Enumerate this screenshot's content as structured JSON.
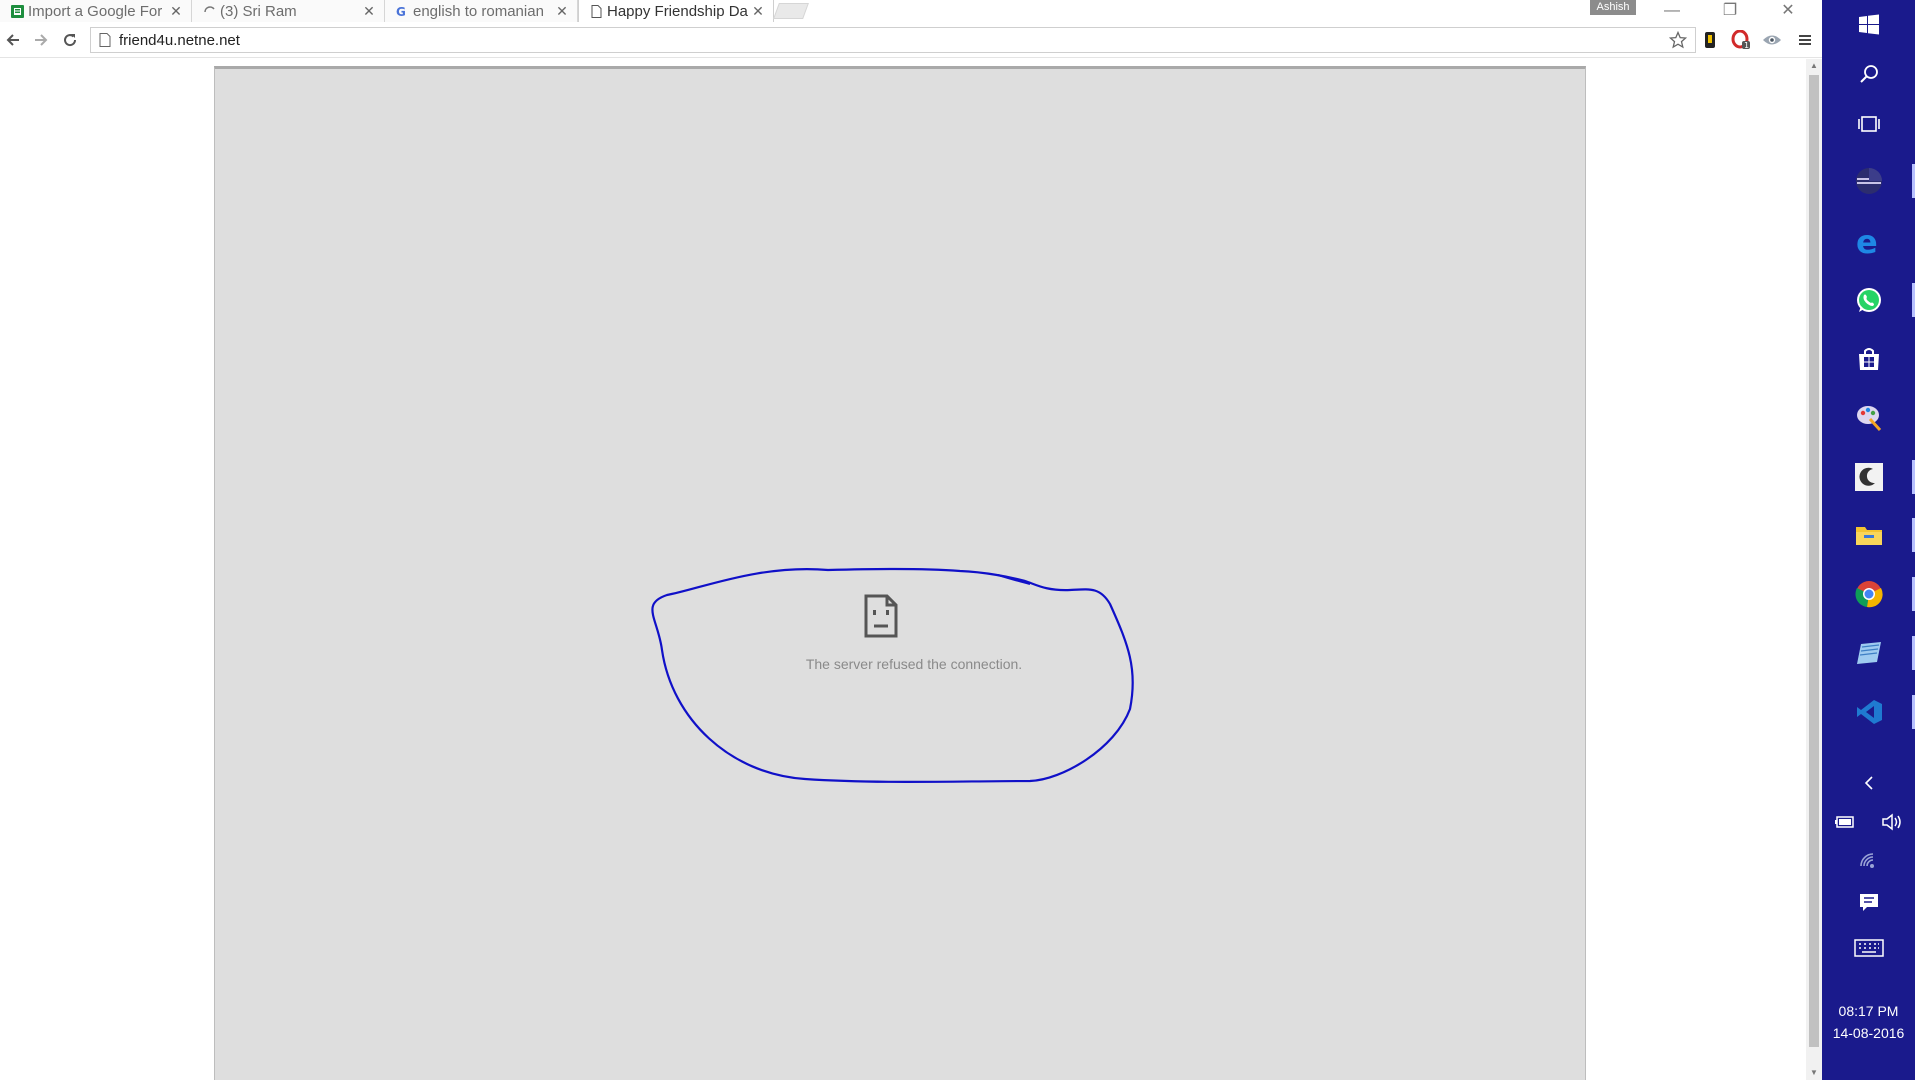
{
  "browser": {
    "tabs": [
      {
        "title": "Import a Google For",
        "active": false
      },
      {
        "title": "(3) Sri Ram",
        "active": false
      },
      {
        "title": "english to romanian",
        "active": false
      },
      {
        "title": "Happy Friendship Da",
        "active": true
      }
    ],
    "profile_name": "Ashish",
    "address_bar": {
      "url": "friend4u.netne.net"
    }
  },
  "page": {
    "error_message": "The server refused the connection."
  },
  "taskbar": {
    "icons": [
      "windows-start-icon",
      "search-icon",
      "task-view-icon",
      "eclipse-icon",
      "edge-icon",
      "whatsapp-icon",
      "store-icon",
      "paint-icon",
      "moon-app-icon",
      "file-explorer-icon",
      "chrome-icon",
      "notepad-icon",
      "vscode-icon"
    ],
    "tray": [
      "show-hidden-icons-icon",
      "battery-icon",
      "volume-icon",
      "network-icon",
      "action-center-icon",
      "keyboard-icon"
    ],
    "clock": {
      "time": "08:17 PM",
      "date": "14-08-2016"
    }
  },
  "colors": {
    "taskbar": "#1a1a8c",
    "page_background": "#dedede",
    "annotation_stroke": "#1010c8"
  }
}
